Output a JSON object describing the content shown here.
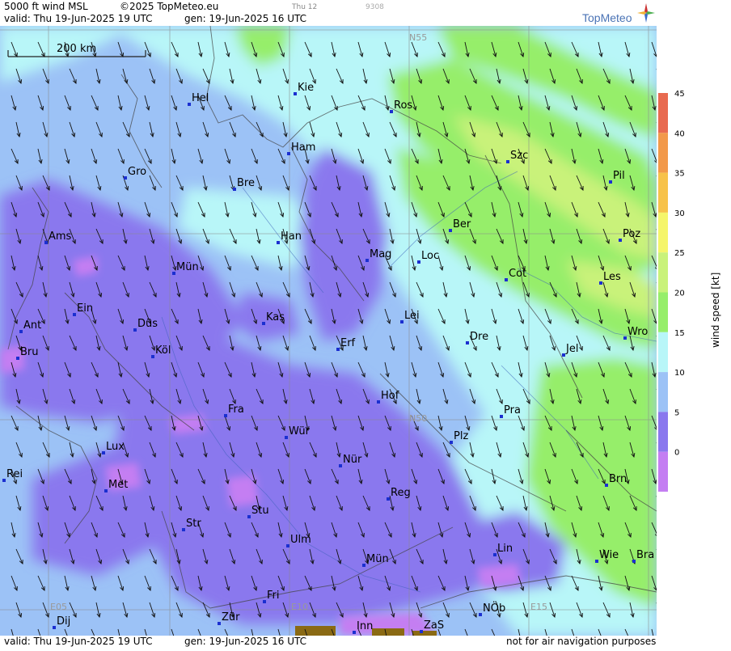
{
  "header": {
    "title": "5000 ft wind MSL",
    "copyright": "©2025 TopMeteo.eu",
    "valid": "valid:  Thu  19-Jun-2025  19 UTC",
    "generated": "gen: 19-Jun-2025 16 UTC",
    "small_day": "Thu 12",
    "small_code": "9308",
    "logo": "TopMeteo"
  },
  "footer": {
    "valid": "valid:  Thu  19-Jun-2025  19 UTC",
    "generated": "gen: 19-Jun-2025 16 UTC",
    "note": "not for air navigation purposes"
  },
  "scale_bar": "200 km",
  "grid_labels": [
    "N55",
    "N50",
    "E05",
    "E10",
    "E15"
  ],
  "cities": [
    {
      "name": "Kie"
    },
    {
      "name": "Hel"
    },
    {
      "name": "Ros"
    },
    {
      "name": "Ham"
    },
    {
      "name": "Szc"
    },
    {
      "name": "Gro"
    },
    {
      "name": "Bre"
    },
    {
      "name": "Pil"
    },
    {
      "name": "Ber"
    },
    {
      "name": "Ams"
    },
    {
      "name": "Han"
    },
    {
      "name": "Poz"
    },
    {
      "name": "Mag"
    },
    {
      "name": "Loc"
    },
    {
      "name": "Mün"
    },
    {
      "name": "Cot"
    },
    {
      "name": "Les"
    },
    {
      "name": "Ein"
    },
    {
      "name": "Kas"
    },
    {
      "name": "Lei"
    },
    {
      "name": "Ant"
    },
    {
      "name": "Düs"
    },
    {
      "name": "Wro"
    },
    {
      "name": "Dre"
    },
    {
      "name": "Erf"
    },
    {
      "name": "Bru"
    },
    {
      "name": "Köl"
    },
    {
      "name": "Jel"
    },
    {
      "name": "Hof"
    },
    {
      "name": "Fra"
    },
    {
      "name": "Pra"
    },
    {
      "name": "Wür"
    },
    {
      "name": "Plz"
    },
    {
      "name": "Lux"
    },
    {
      "name": "Nür"
    },
    {
      "name": "Rei"
    },
    {
      "name": "Met"
    },
    {
      "name": "Reg"
    },
    {
      "name": "Brn"
    },
    {
      "name": "Stu"
    },
    {
      "name": "Str"
    },
    {
      "name": "Ulm"
    },
    {
      "name": "Lin"
    },
    {
      "name": "Mün"
    },
    {
      "name": "Wie"
    },
    {
      "name": "Bra"
    },
    {
      "name": "Fri"
    },
    {
      "name": "NÖb"
    },
    {
      "name": "Dij"
    },
    {
      "name": "Zür"
    },
    {
      "name": "Inn"
    },
    {
      "name": "ZaS"
    }
  ],
  "legend": {
    "unit_label": "wind speed  [kt]",
    "ticks": [
      "45",
      "40",
      "35",
      "30",
      "25",
      "20",
      "15",
      "10",
      "5",
      "0"
    ],
    "colors": [
      "#e86a50",
      "#f2994a",
      "#f7c24a",
      "#f5f56a",
      "#c9f27a",
      "#96ee6a",
      "#b8f6f8",
      "#9cc2f6",
      "#8a78ee",
      "#c47ef2"
    ]
  },
  "map_colors": {
    "violet": "#8a78ee",
    "pink": "#c47ef2",
    "blue": "#9cc2f6",
    "cyan": "#b8f6f8",
    "green": "#96ee6a",
    "yellowgreen": "#c9f27a",
    "brown": "#8a6a14"
  }
}
